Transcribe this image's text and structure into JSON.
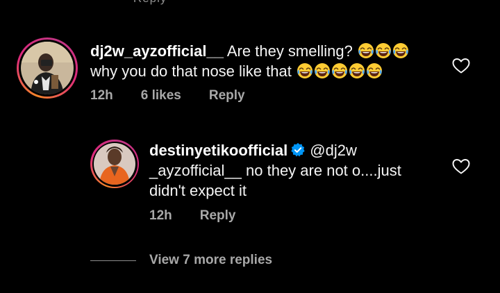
{
  "top_remnant": "·  ·  ·  ·  ·  Reply",
  "comments": [
    {
      "username": "dj2w_ayzofficial__",
      "text_line1": " Are they smelling?",
      "text_line2": "why you do that nose like that",
      "emoji_icon": "laughing-tears-emoji",
      "time": "12h",
      "likes": "6 likes",
      "reply_label": "Reply",
      "like_icon": "heart-outline-icon"
    },
    {
      "username": "destinyetikoofficial",
      "verified_icon": "verified-badge-icon",
      "text": "@dj2w _ayzofficial__ no they are not o....just didn't expect it",
      "time": "12h",
      "reply_label": "Reply",
      "like_icon": "heart-outline-icon"
    }
  ],
  "view_replies": {
    "label": "View 7 more replies"
  },
  "colors": {
    "background": "#000000",
    "primary_text": "#f5f5f5",
    "secondary_text": "#a8a8a8",
    "verified_blue": "#0095f6",
    "story_ring_start": "#f58529",
    "story_ring_end": "#dd2a7b"
  }
}
